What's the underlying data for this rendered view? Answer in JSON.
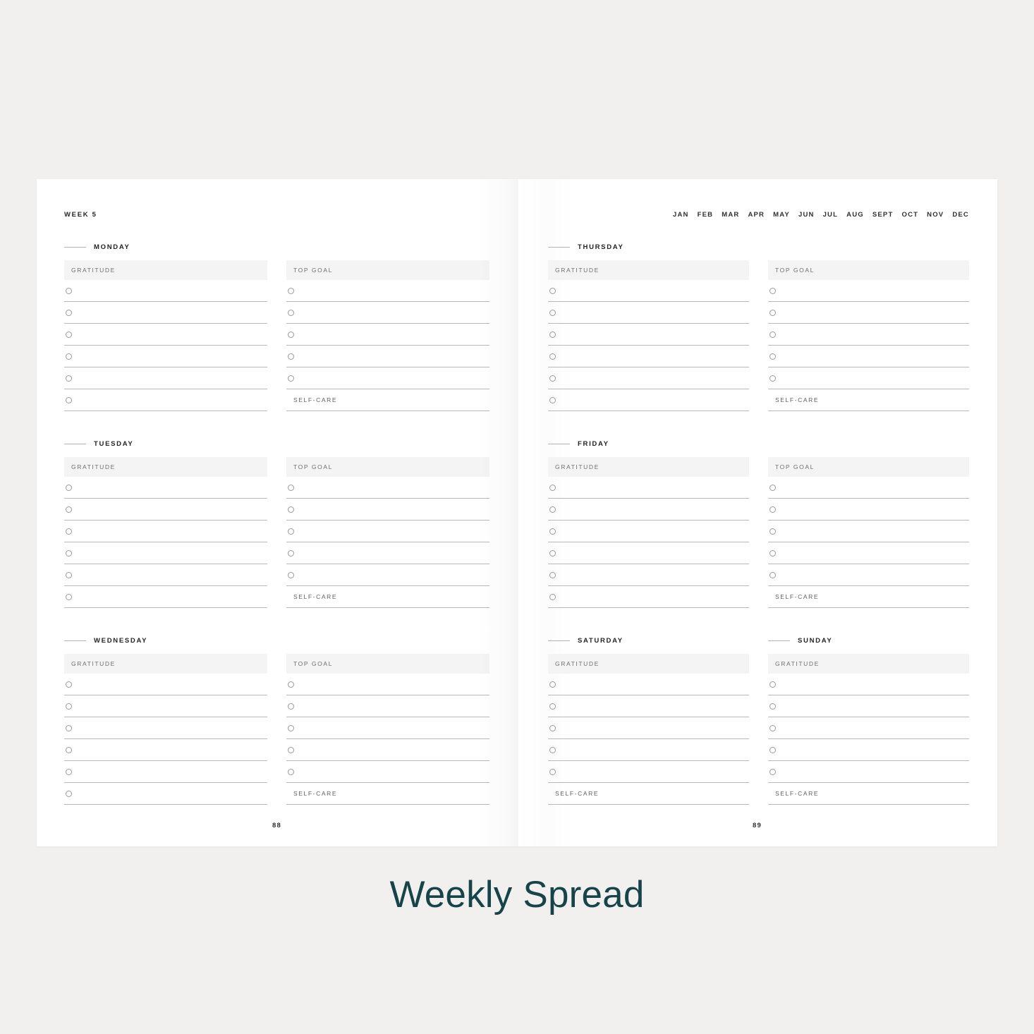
{
  "caption": "Weekly Spread",
  "accent_color": "#17434a",
  "background_color": "#f1f0ee",
  "page_color": "#ffffff",
  "header_bar_color": "#f4f4f4",
  "left_page": {
    "week_label": "WEEK 5",
    "page_number": "88",
    "days": [
      {
        "name": "MONDAY",
        "columns": [
          {
            "header": "GRATITUDE",
            "circle_rows": 6,
            "selfcare": null
          },
          {
            "header": "TOP GOAL",
            "circle_rows": 5,
            "selfcare": "SELF-CARE"
          }
        ]
      },
      {
        "name": "TUESDAY",
        "columns": [
          {
            "header": "GRATITUDE",
            "circle_rows": 6,
            "selfcare": null
          },
          {
            "header": "TOP GOAL",
            "circle_rows": 5,
            "selfcare": "SELF-CARE"
          }
        ]
      },
      {
        "name": "WEDNESDAY",
        "columns": [
          {
            "header": "GRATITUDE",
            "circle_rows": 6,
            "selfcare": null
          },
          {
            "header": "TOP GOAL",
            "circle_rows": 5,
            "selfcare": "SELF-CARE"
          }
        ]
      }
    ]
  },
  "right_page": {
    "page_number": "89",
    "months": [
      "JAN",
      "FEB",
      "MAR",
      "APR",
      "MAY",
      "JUN",
      "JUL",
      "AUG",
      "SEPT",
      "OCT",
      "NOV",
      "DEC"
    ],
    "days": [
      {
        "name": "THURSDAY",
        "columns": [
          {
            "header": "GRATITUDE",
            "circle_rows": 6,
            "selfcare": null
          },
          {
            "header": "TOP GOAL",
            "circle_rows": 5,
            "selfcare": "SELF-CARE"
          }
        ]
      },
      {
        "name": "FRIDAY",
        "columns": [
          {
            "header": "GRATITUDE",
            "circle_rows": 6,
            "selfcare": null
          },
          {
            "header": "TOP GOAL",
            "circle_rows": 5,
            "selfcare": "SELF-CARE"
          }
        ]
      },
      {
        "name": "SATURDAY",
        "columns": [
          {
            "header": "GRATITUDE",
            "circle_rows": 5,
            "selfcare": "SELF-CARE"
          }
        ]
      },
      {
        "name": "SUNDAY",
        "columns": [
          {
            "header": "GRATITUDE",
            "circle_rows": 5,
            "selfcare": "SELF-CARE"
          }
        ]
      }
    ]
  }
}
